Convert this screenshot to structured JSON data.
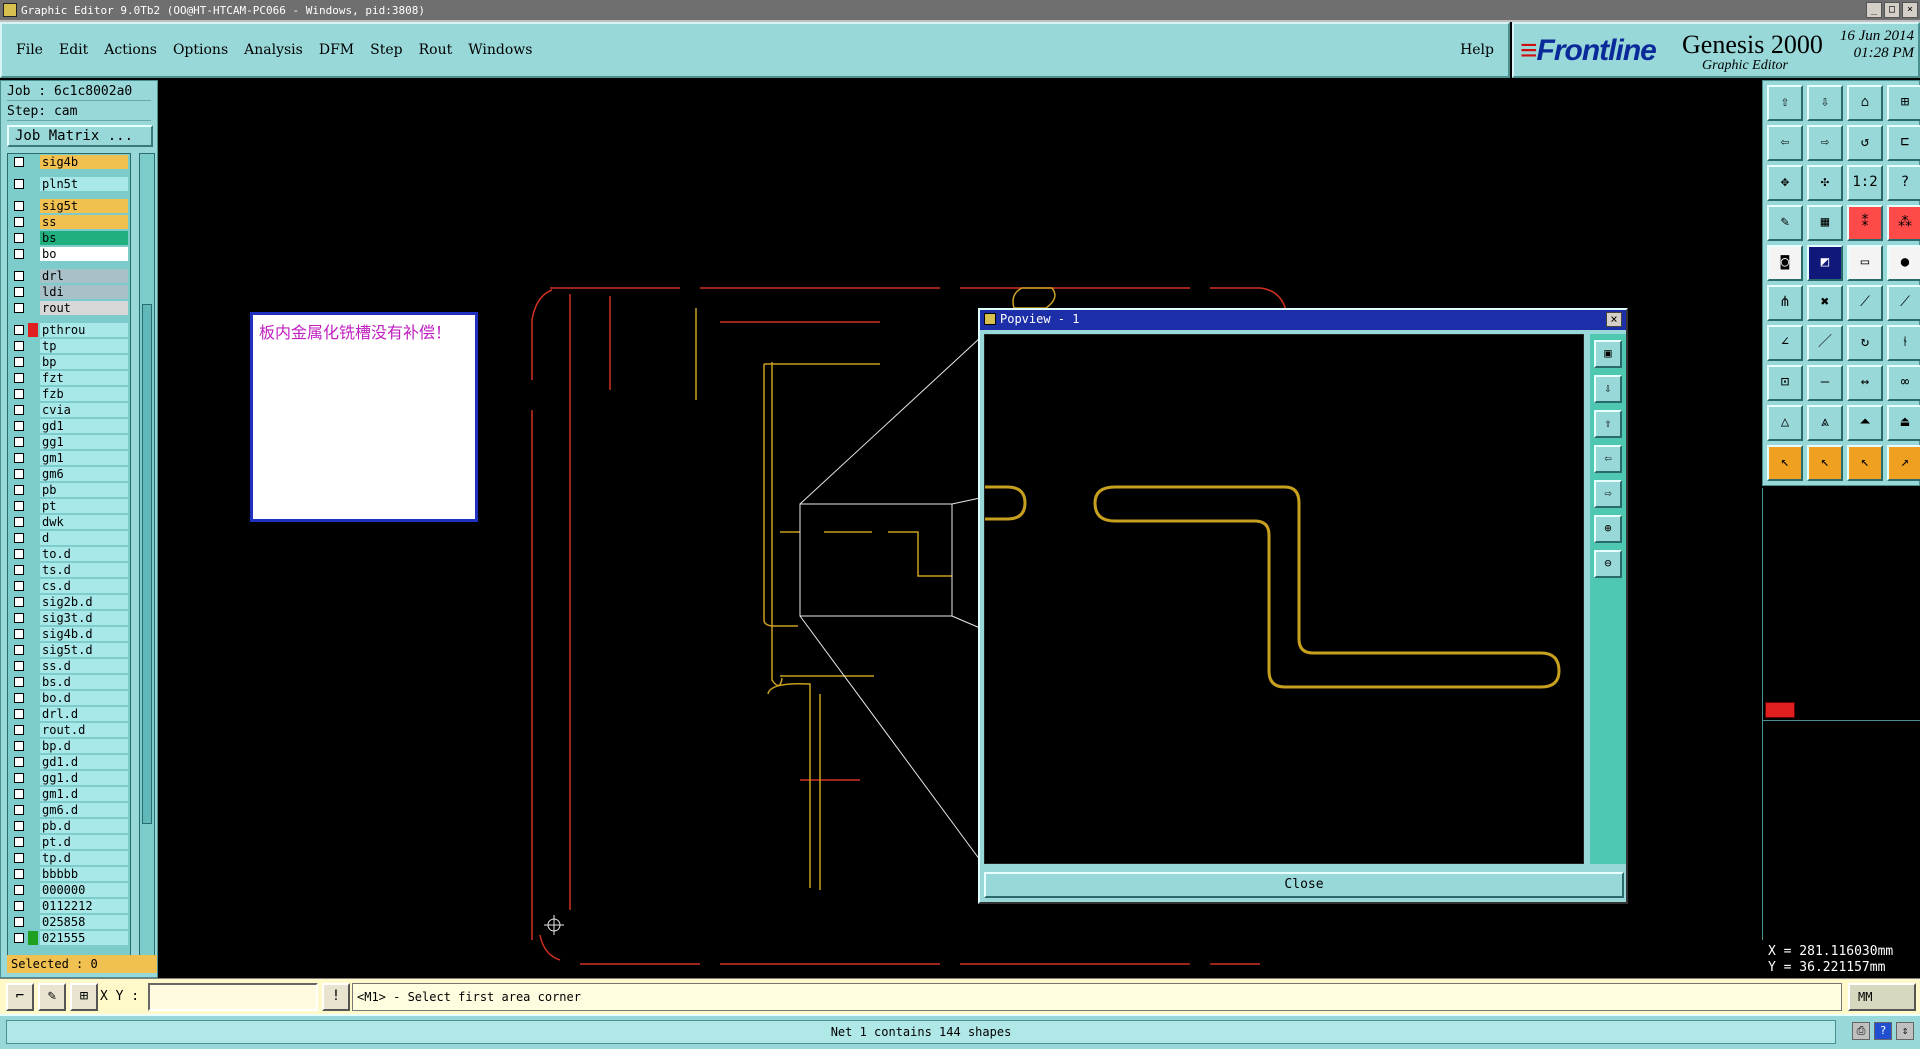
{
  "window": {
    "title": "Graphic Editor 9.0Tb2 (OO@HT-HTCAM-PC066 - Windows, pid:3808)"
  },
  "menu": {
    "items": [
      "File",
      "Edit",
      "Actions",
      "Options",
      "Analysis",
      "DFM",
      "Step",
      "Rout",
      "Windows"
    ],
    "help": "Help"
  },
  "brand": {
    "logo": "Frontline",
    "product": "Genesis 2000",
    "subtitle": "Graphic Editor",
    "date": "16 Jun 2014",
    "time": "01:28 PM"
  },
  "job": {
    "job_label": "Job : 6c1c8002a0",
    "step_label": "Step: cam",
    "matrix_button": "Job Matrix ..."
  },
  "layers": [
    {
      "name": "sig4b",
      "color": "#f0c050",
      "swatch": ""
    },
    {
      "name": "pln5t",
      "color": "#a8e8e8",
      "swatch": "",
      "gap": true
    },
    {
      "name": "sig5t",
      "color": "#f0c050",
      "swatch": "",
      "gap": true
    },
    {
      "name": "ss",
      "color": "#f0c050",
      "swatch": ""
    },
    {
      "name": "bs",
      "color": "#20b080",
      "swatch": ""
    },
    {
      "name": "bo",
      "color": "#ffffff",
      "swatch": ""
    },
    {
      "name": "drl",
      "color": "#a8c0c8",
      "swatch": "",
      "gap": true
    },
    {
      "name": "ldi",
      "color": "#a8c0c8",
      "swatch": ""
    },
    {
      "name": "rout",
      "color": "#d8d8d8",
      "swatch": ""
    },
    {
      "name": "pthrou",
      "color": "#a8e8e8",
      "swatch": "#e02020",
      "gap": true
    },
    {
      "name": "tp",
      "color": "#a8e8e8",
      "swatch": ""
    },
    {
      "name": "bp",
      "color": "#a8e8e8",
      "swatch": ""
    },
    {
      "name": "fzt",
      "color": "#a8e8e8",
      "swatch": ""
    },
    {
      "name": "fzb",
      "color": "#a8e8e8",
      "swatch": ""
    },
    {
      "name": "cvia",
      "color": "#a8e8e8",
      "swatch": ""
    },
    {
      "name": "gd1",
      "color": "#a8e8e8",
      "swatch": ""
    },
    {
      "name": "gg1",
      "color": "#a8e8e8",
      "swatch": ""
    },
    {
      "name": "gm1",
      "color": "#a8e8e8",
      "swatch": ""
    },
    {
      "name": "gm6",
      "color": "#a8e8e8",
      "swatch": ""
    },
    {
      "name": "pb",
      "color": "#a8e8e8",
      "swatch": ""
    },
    {
      "name": "pt",
      "color": "#a8e8e8",
      "swatch": ""
    },
    {
      "name": "dwk",
      "color": "#a8e8e8",
      "swatch": ""
    },
    {
      "name": "d",
      "color": "#a8e8e8",
      "swatch": ""
    },
    {
      "name": "to.d",
      "color": "#a8e8e8",
      "swatch": ""
    },
    {
      "name": "ts.d",
      "color": "#a8e8e8",
      "swatch": ""
    },
    {
      "name": "cs.d",
      "color": "#a8e8e8",
      "swatch": ""
    },
    {
      "name": "sig2b.d",
      "color": "#a8e8e8",
      "swatch": ""
    },
    {
      "name": "sig3t.d",
      "color": "#a8e8e8",
      "swatch": ""
    },
    {
      "name": "sig4b.d",
      "color": "#a8e8e8",
      "swatch": ""
    },
    {
      "name": "sig5t.d",
      "color": "#a8e8e8",
      "swatch": ""
    },
    {
      "name": "ss.d",
      "color": "#a8e8e8",
      "swatch": ""
    },
    {
      "name": "bs.d",
      "color": "#a8e8e8",
      "swatch": ""
    },
    {
      "name": "bo.d",
      "color": "#a8e8e8",
      "swatch": ""
    },
    {
      "name": "drl.d",
      "color": "#a8e8e8",
      "swatch": ""
    },
    {
      "name": "rout.d",
      "color": "#a8e8e8",
      "swatch": ""
    },
    {
      "name": "bp.d",
      "color": "#a8e8e8",
      "swatch": ""
    },
    {
      "name": "gd1.d",
      "color": "#a8e8e8",
      "swatch": ""
    },
    {
      "name": "gg1.d",
      "color": "#a8e8e8",
      "swatch": ""
    },
    {
      "name": "gm1.d",
      "color": "#a8e8e8",
      "swatch": ""
    },
    {
      "name": "gm6.d",
      "color": "#a8e8e8",
      "swatch": ""
    },
    {
      "name": "pb.d",
      "color": "#a8e8e8",
      "swatch": ""
    },
    {
      "name": "pt.d",
      "color": "#a8e8e8",
      "swatch": ""
    },
    {
      "name": "tp.d",
      "color": "#a8e8e8",
      "swatch": ""
    },
    {
      "name": "bbbbb",
      "color": "#a8e8e8",
      "swatch": ""
    },
    {
      "name": "000000",
      "color": "#a8e8e8",
      "swatch": ""
    },
    {
      "name": "0112212",
      "color": "#a8e8e8",
      "swatch": ""
    },
    {
      "name": "025858",
      "color": "#a8e8e8",
      "swatch": ""
    },
    {
      "name": "021555",
      "color": "#a8e8e8",
      "swatch": "#20a020"
    }
  ],
  "selected": "Selected : 0",
  "note": {
    "text": "板内金属化铣槽没有补偿！"
  },
  "popview": {
    "title": "Popview - 1",
    "close_label": "Close"
  },
  "coords": {
    "x": "X = 281.116030mm",
    "y": "Y = 36.221157mm"
  },
  "command": {
    "xy_label": "X Y :",
    "xy_value": "",
    "message": "<M1> - Select first area corner",
    "unit": "MM"
  },
  "status": {
    "text": "Net 1 contains 144 shapes"
  },
  "colors": {
    "teal": "#98d8d8",
    "rout_red": "#d03020",
    "trace_gold": "#c8a020"
  }
}
